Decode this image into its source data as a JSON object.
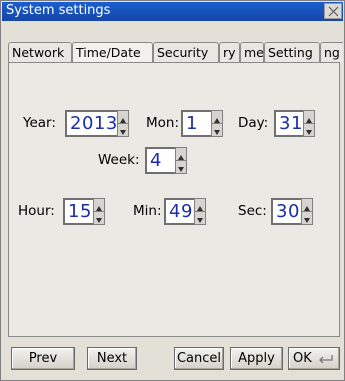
{
  "window": {
    "title": "System settings"
  },
  "tabs": [
    {
      "label": "Network"
    },
    {
      "label": "Time/Date"
    },
    {
      "label": "Security"
    },
    {
      "label": "ry"
    },
    {
      "label": "me"
    },
    {
      "label": "Setting"
    },
    {
      "label": "ng"
    }
  ],
  "fields": {
    "year": {
      "label": "Year:",
      "value": "2013"
    },
    "mon": {
      "label": "Mon:",
      "value": "1"
    },
    "day": {
      "label": "Day:",
      "value": "31"
    },
    "week": {
      "label": "Week:",
      "value": "4"
    },
    "hour": {
      "label": "Hour:",
      "value": "15"
    },
    "min": {
      "label": "Min:",
      "value": "49"
    },
    "sec": {
      "label": "Sec:",
      "value": "30"
    }
  },
  "buttons": {
    "prev": "Prev",
    "next": "Next",
    "cancel": "Cancel",
    "apply": "Apply",
    "ok": "OK"
  },
  "colors": {
    "titlebar": "#1a5fcf",
    "value_text": "#1a2fa8"
  }
}
